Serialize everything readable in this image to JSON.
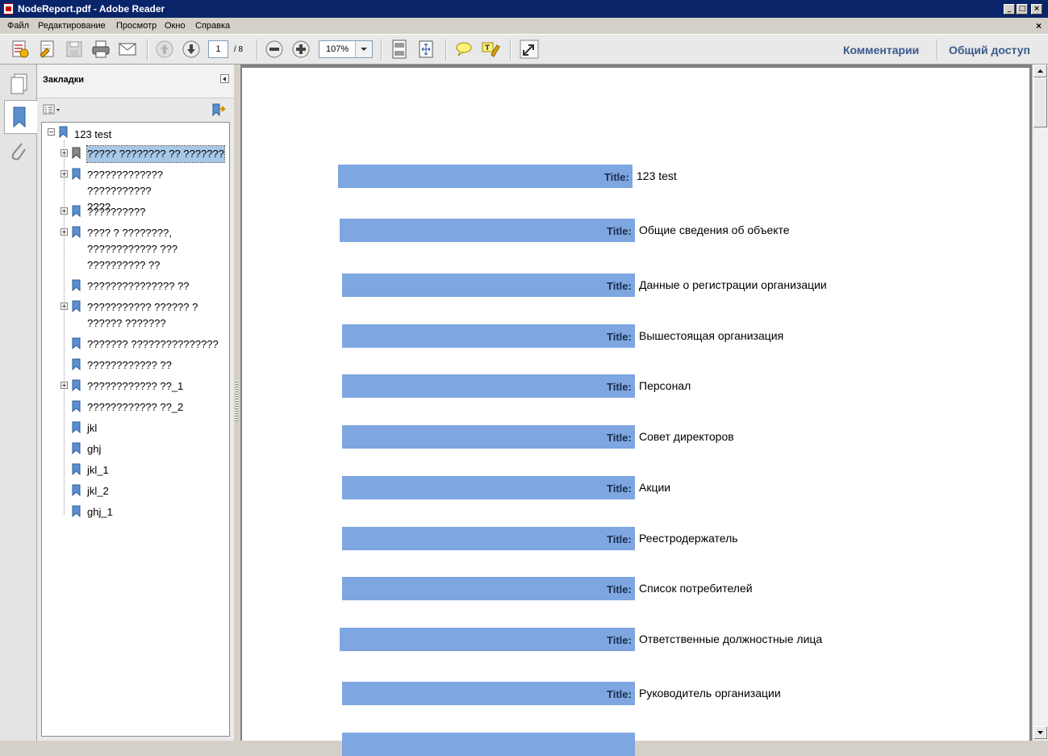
{
  "window": {
    "title": "NodeReport.pdf - Adobe Reader",
    "min": "_",
    "max": "□",
    "close": "×"
  },
  "menu": {
    "items": [
      "Файл",
      "Редактирование",
      "Просмотр",
      "Окно",
      "Справка"
    ],
    "close_doc": "×"
  },
  "toolbar": {
    "page_current": "1",
    "page_total": "/ 8",
    "zoom": "107%",
    "comments": "Комментарии",
    "share": "Общий доступ"
  },
  "bookmarks": {
    "header": "Закладки",
    "root": "123 test",
    "items": [
      {
        "label": "????? ???????? ?? ???????",
        "expandable": true,
        "selected": true
      },
      {
        "label": "????????????? ???????????",
        "label2": "????",
        "expandable": true
      },
      {
        "label": "??????????",
        "expandable": true
      },
      {
        "label": "???? ? ????????,",
        "label2": "???????????? ???",
        "label3": "?????????? ??",
        "expandable": true
      },
      {
        "label": "??????????????? ??",
        "expandable": false
      },
      {
        "label": "??????????? ?????? ?",
        "label2": "?????? ???????",
        "expandable": true
      },
      {
        "label": "??????? ???????????????",
        "expandable": false
      },
      {
        "label": "???????????? ??",
        "expandable": false
      },
      {
        "label": "???????????? ??_1",
        "expandable": true
      },
      {
        "label": "???????????? ??_2",
        "expandable": false
      },
      {
        "label": "jkl",
        "expandable": false
      },
      {
        "label": "ghj",
        "expandable": false
      },
      {
        "label": "jkl_1",
        "expandable": false
      },
      {
        "label": "jkl_2",
        "expandable": false
      },
      {
        "label": "ghj_1",
        "expandable": false
      }
    ]
  },
  "document": {
    "label": "Title:",
    "rows": [
      "123 test",
      "Общие сведения об объекте",
      "Данные о регистрации организации",
      "Вышестоящая организация",
      "Персонал",
      "Совет директоров",
      "Акции",
      "Реестродержатель",
      "Список потребителей",
      "Ответственные должностные лица",
      "Руководитель организации",
      ""
    ],
    "bar_color": "#7ea6e0"
  }
}
